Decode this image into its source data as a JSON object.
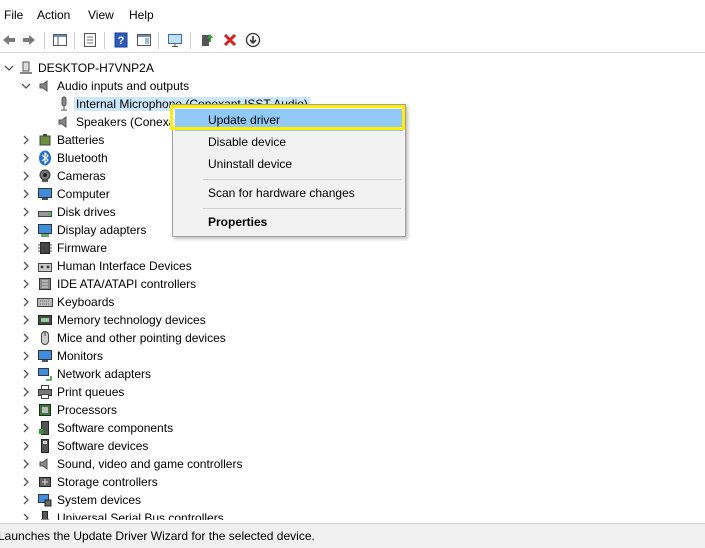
{
  "menu": {
    "file": "File",
    "action": "Action",
    "view": "View",
    "help": "Help"
  },
  "toolbar": {
    "buttons": [
      "back-icon",
      "forward-icon",
      "console-tree-icon",
      "properties-icon",
      "help-icon",
      "action-pane-icon",
      "monitor-scan-icon",
      "add-driver-icon",
      "uninstall-icon",
      "disable-icon"
    ]
  },
  "tree": {
    "root": "DESKTOP-H7VNP2A",
    "audio": {
      "label": "Audio inputs and outputs",
      "children": [
        "Internal Microphone (Conexant ISST Audio)",
        "Speakers (Conexa"
      ]
    },
    "categories": [
      "Batteries",
      "Bluetooth",
      "Cameras",
      "Computer",
      "Disk drives",
      "Display adapters",
      "Firmware",
      "Human Interface Devices",
      "IDE ATA/ATAPI controllers",
      "Keyboards",
      "Memory technology devices",
      "Mice and other pointing devices",
      "Monitors",
      "Network adapters",
      "Print queues",
      "Processors",
      "Software components",
      "Software devices",
      "Sound, video and game controllers",
      "Storage controllers",
      "System devices",
      "Universal Serial Bus controllers"
    ]
  },
  "context_menu": {
    "update": "Update driver",
    "disable": "Disable device",
    "uninstall": "Uninstall device",
    "scan": "Scan for hardware changes",
    "properties": "Properties"
  },
  "status": "Launches the Update Driver Wizard for the selected device.",
  "colors": {
    "selection": "#91c9f7",
    "highlight_box": "#ffee00",
    "item_hover": "#cce8ff"
  }
}
